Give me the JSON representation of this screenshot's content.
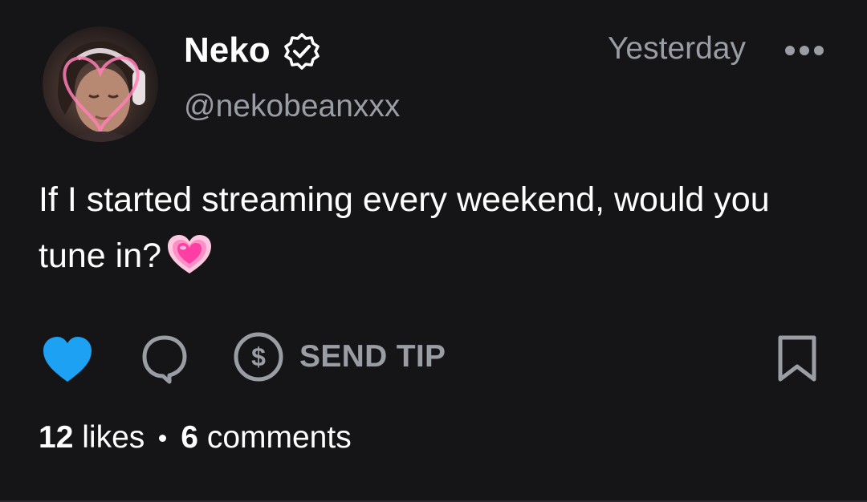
{
  "post": {
    "author": {
      "display_name": "Neko",
      "handle": "@nekobeanxxx",
      "verified": true,
      "avatar_icon": "profile-photo"
    },
    "timestamp": "Yesterday",
    "text": "If I started streaming every weekend, would you tune in?",
    "emoji": "growing-heart",
    "actions": {
      "like_icon": "heart-icon",
      "like_color": "#1da1f2",
      "comment_icon": "comment-icon",
      "tip_icon": "dollar-icon",
      "tip_label": "SEND TIP",
      "bookmark_icon": "bookmark-icon"
    },
    "stats": {
      "likes_count": "12",
      "likes_label": "likes",
      "comments_count": "6",
      "comments_label": "comments"
    }
  },
  "colors": {
    "background": "#151417",
    "text": "#ffffff",
    "muted": "#9a9da4",
    "accent_blue": "#1da1f2",
    "emoji_pink": "#ff3ea5"
  }
}
